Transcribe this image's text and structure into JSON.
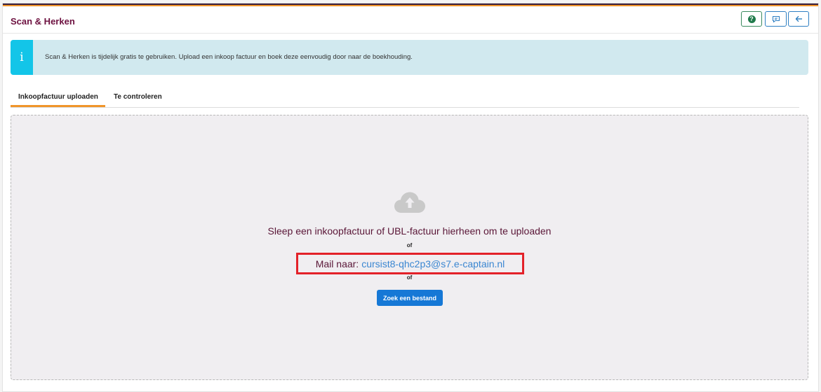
{
  "colors": {
    "stripe_top": "#3a1f3d",
    "stripe_bottom": "#f0952a",
    "title": "#6d1140",
    "alert_bg": "#d1e9ef",
    "alert_icon_bg": "#13c5e8",
    "tab_active_underline": "#f0952a",
    "mail_highlight": "#e32129",
    "primary_button": "#1678d6",
    "link": "#3a86d1"
  },
  "header": {
    "title": "Scan & Herken",
    "buttons": [
      {
        "name": "help",
        "icon": "question-circle-icon"
      },
      {
        "name": "feedback",
        "icon": "comment-icon"
      },
      {
        "name": "back",
        "icon": "arrow-left-icon"
      }
    ]
  },
  "alert": {
    "icon": "info-icon",
    "icon_glyph": "i",
    "text": "Scan & Herken is tijdelijk gratis te gebruiken. Upload een inkoop factuur en boek deze eenvoudig door naar de boekhouding."
  },
  "tabs": [
    {
      "label": "Inkoopfactuur uploaden",
      "active": true
    },
    {
      "label": "Te controleren",
      "active": false
    }
  ],
  "dropzone": {
    "icon": "cloud-upload-icon",
    "heading": "Sleep een inkoopfactuur of UBL-factuur hierheen om te uploaden",
    "or_1": "of",
    "mail_label": "Mail naar:",
    "mail_address": "cursist8-qhc2p3@s7.e-captain.nl",
    "or_2": "of",
    "button_label": "Zoek een bestand"
  }
}
